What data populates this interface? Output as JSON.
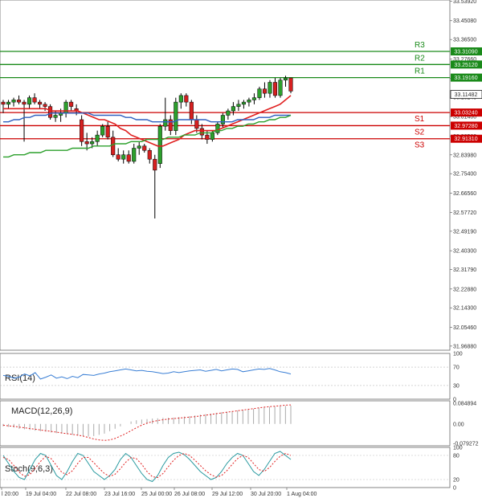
{
  "chart_data": {
    "type": "candlestick",
    "instrument_pane": {
      "ylim": [
        31.95,
        33.545
      ],
      "y_ticks": [
        "33.53920",
        "33.45080",
        "33.36500",
        "33.27660",
        "33.18820",
        "33.10240",
        "33.01400",
        "32.92560",
        "32.83980",
        "32.75400",
        "32.66560",
        "32.57720",
        "32.49190",
        "32.40300",
        "32.31790",
        "32.22880",
        "32.14300",
        "32.05460",
        "31.96880"
      ],
      "current_price": {
        "label": "33.11482",
        "value": 33.11482
      },
      "levels": [
        {
          "name": "R3",
          "value": 33.3109,
          "label": "33.31090",
          "color": "#1a8a1a"
        },
        {
          "name": "R2",
          "value": 33.2512,
          "label": "33.25120",
          "color": "#1a8a1a"
        },
        {
          "name": "R1",
          "value": 33.1916,
          "label": "33.19160",
          "color": "#1a8a1a"
        },
        {
          "name": "S1",
          "value": 33.0324,
          "label": "33.03240",
          "color": "#cc0000"
        },
        {
          "name": "S2",
          "value": 32.9728,
          "label": "32.97280",
          "color": "#cc0000"
        },
        {
          "name": "S3",
          "value": 32.9131,
          "label": "32.91310",
          "color": "#cc0000"
        }
      ],
      "candles": [
        {
          "o": 33.08,
          "h": 33.09,
          "l": 33.03,
          "c": 33.07
        },
        {
          "o": 33.07,
          "h": 33.09,
          "l": 33.05,
          "c": 33.08
        },
        {
          "o": 33.08,
          "h": 33.1,
          "l": 33.06,
          "c": 33.09
        },
        {
          "o": 33.09,
          "h": 33.11,
          "l": 33.07,
          "c": 33.08
        },
        {
          "o": 33.08,
          "h": 33.09,
          "l": 32.9,
          "c": 33.07
        },
        {
          "o": 33.07,
          "h": 33.11,
          "l": 33.05,
          "c": 33.1
        },
        {
          "o": 33.1,
          "h": 33.12,
          "l": 33.07,
          "c": 33.08
        },
        {
          "o": 33.08,
          "h": 33.09,
          "l": 33.05,
          "c": 33.07
        },
        {
          "o": 33.07,
          "h": 33.08,
          "l": 33.04,
          "c": 33.06
        },
        {
          "o": 33.06,
          "h": 33.07,
          "l": 33.0,
          "c": 33.01
        },
        {
          "o": 33.01,
          "h": 33.04,
          "l": 32.99,
          "c": 33.02
        },
        {
          "o": 33.02,
          "h": 33.05,
          "l": 32.99,
          "c": 33.03
        },
        {
          "o": 33.03,
          "h": 33.09,
          "l": 33.01,
          "c": 33.08
        },
        {
          "o": 33.08,
          "h": 33.09,
          "l": 33.04,
          "c": 33.06
        },
        {
          "o": 33.05,
          "h": 33.07,
          "l": 33.02,
          "c": 33.04
        },
        {
          "o": 33.0,
          "h": 33.02,
          "l": 32.88,
          "c": 32.9
        },
        {
          "o": 32.9,
          "h": 32.94,
          "l": 32.86,
          "c": 32.89
        },
        {
          "o": 32.89,
          "h": 32.92,
          "l": 32.87,
          "c": 32.9
        },
        {
          "o": 32.9,
          "h": 32.95,
          "l": 32.88,
          "c": 32.93
        },
        {
          "o": 32.93,
          "h": 32.98,
          "l": 32.92,
          "c": 32.97
        },
        {
          "o": 32.97,
          "h": 32.99,
          "l": 32.91,
          "c": 32.92
        },
        {
          "o": 32.92,
          "h": 32.95,
          "l": 32.83,
          "c": 32.84
        },
        {
          "o": 32.84,
          "h": 32.87,
          "l": 32.81,
          "c": 32.82
        },
        {
          "o": 32.82,
          "h": 32.86,
          "l": 32.8,
          "c": 32.84
        },
        {
          "o": 32.84,
          "h": 32.86,
          "l": 32.8,
          "c": 32.81
        },
        {
          "o": 32.81,
          "h": 32.89,
          "l": 32.8,
          "c": 32.87
        },
        {
          "o": 32.87,
          "h": 32.9,
          "l": 32.84,
          "c": 32.88
        },
        {
          "o": 32.88,
          "h": 32.89,
          "l": 32.85,
          "c": 32.86
        },
        {
          "o": 32.86,
          "h": 32.87,
          "l": 32.8,
          "c": 32.82
        },
        {
          "o": 32.82,
          "h": 32.84,
          "l": 32.55,
          "c": 32.77
        },
        {
          "o": 32.8,
          "h": 32.98,
          "l": 32.78,
          "c": 32.97
        },
        {
          "o": 32.97,
          "h": 33.1,
          "l": 32.95,
          "c": 33.0
        },
        {
          "o": 33.0,
          "h": 33.02,
          "l": 32.93,
          "c": 32.95
        },
        {
          "o": 32.95,
          "h": 33.1,
          "l": 32.93,
          "c": 33.08
        },
        {
          "o": 33.08,
          "h": 33.12,
          "l": 33.05,
          "c": 33.11
        },
        {
          "o": 33.11,
          "h": 33.12,
          "l": 33.06,
          "c": 33.08
        },
        {
          "o": 33.08,
          "h": 33.09,
          "l": 32.98,
          "c": 33.0
        },
        {
          "o": 33.0,
          "h": 33.02,
          "l": 32.94,
          "c": 32.96
        },
        {
          "o": 32.96,
          "h": 32.98,
          "l": 32.91,
          "c": 32.93
        },
        {
          "o": 32.93,
          "h": 32.95,
          "l": 32.89,
          "c": 32.91
        },
        {
          "o": 32.91,
          "h": 32.95,
          "l": 32.9,
          "c": 32.94
        },
        {
          "o": 32.94,
          "h": 32.99,
          "l": 32.93,
          "c": 32.98
        },
        {
          "o": 32.98,
          "h": 33.03,
          "l": 32.96,
          "c": 33.02
        },
        {
          "o": 33.02,
          "h": 33.05,
          "l": 33.0,
          "c": 33.04
        },
        {
          "o": 33.04,
          "h": 33.08,
          "l": 33.02,
          "c": 33.06
        },
        {
          "o": 33.06,
          "h": 33.09,
          "l": 33.04,
          "c": 33.07
        },
        {
          "o": 33.07,
          "h": 33.09,
          "l": 33.05,
          "c": 33.08
        },
        {
          "o": 33.08,
          "h": 33.1,
          "l": 33.06,
          "c": 33.09
        },
        {
          "o": 33.09,
          "h": 33.12,
          "l": 33.07,
          "c": 33.1
        },
        {
          "o": 33.1,
          "h": 33.15,
          "l": 33.09,
          "c": 33.14
        },
        {
          "o": 33.14,
          "h": 33.17,
          "l": 33.1,
          "c": 33.12
        },
        {
          "o": 33.12,
          "h": 33.18,
          "l": 33.1,
          "c": 33.17
        },
        {
          "o": 33.17,
          "h": 33.19,
          "l": 33.1,
          "c": 33.11
        },
        {
          "o": 33.11,
          "h": 33.19,
          "l": 33.1,
          "c": 33.18
        },
        {
          "o": 33.18,
          "h": 33.2,
          "l": 33.15,
          "c": 33.19
        },
        {
          "o": 33.19,
          "h": 33.19,
          "l": 33.12,
          "c": 33.13
        }
      ],
      "moving_averages": [
        {
          "color": "#e02020",
          "values": [
            33.05,
            33.05,
            33.05,
            33.05,
            33.05,
            33.05,
            33.05,
            33.05,
            33.05,
            33.04,
            33.04,
            33.04,
            33.04,
            33.04,
            33.04,
            33.03,
            33.02,
            33.01,
            33.0,
            33.0,
            32.99,
            32.98,
            32.96,
            32.95,
            32.93,
            32.92,
            32.91,
            32.9,
            32.89,
            32.88,
            32.88,
            32.89,
            32.9,
            32.91,
            32.93,
            32.94,
            32.95,
            32.95,
            32.95,
            32.95,
            32.95,
            32.96,
            32.97,
            32.98,
            32.99,
            33.0,
            33.01,
            33.02,
            33.03,
            33.04,
            33.05,
            33.06,
            33.07,
            33.09,
            33.11
          ]
        },
        {
          "color": "#3060c0",
          "values": [
            32.99,
            32.99,
            33.0,
            33.0,
            33.01,
            33.01,
            33.02,
            33.02,
            33.02,
            33.03,
            33.03,
            33.03,
            33.03,
            33.03,
            33.03,
            33.03,
            33.03,
            33.02,
            33.02,
            33.02,
            33.02,
            33.02,
            33.02,
            33.01,
            33.01,
            33.0,
            33.0,
            33.0,
            32.99,
            32.99,
            32.99,
            32.99,
            32.99,
            33.0,
            33.0,
            33.0,
            33.0,
            33.0,
            33.0,
            32.99,
            32.99,
            32.99,
            32.99,
            32.99,
            33.0,
            33.0,
            33.0,
            33.0,
            33.01,
            33.01,
            33.01,
            33.02,
            33.02,
            33.02,
            33.02
          ]
        },
        {
          "color": "#2ca02c",
          "values": [
            32.83,
            32.83,
            32.84,
            32.84,
            32.84,
            32.85,
            32.85,
            32.85,
            32.86,
            32.86,
            32.86,
            32.86,
            32.86,
            32.87,
            32.87,
            32.87,
            32.87,
            32.88,
            32.88,
            32.88,
            32.88,
            32.89,
            32.89,
            32.89,
            32.9,
            32.9,
            32.9,
            32.91,
            32.91,
            32.91,
            32.91,
            32.92,
            32.92,
            32.92,
            32.93,
            32.93,
            32.93,
            32.94,
            32.94,
            32.94,
            32.95,
            32.95,
            32.96,
            32.96,
            32.97,
            32.97,
            32.98,
            32.98,
            32.99,
            32.99,
            33.0,
            33.0,
            33.01,
            33.01,
            33.02
          ]
        }
      ]
    },
    "rsi": {
      "label": "RSI(14)",
      "ylim": [
        0,
        100
      ],
      "y_ticks": [
        "100",
        "70",
        "30",
        "0"
      ],
      "values": [
        52,
        50,
        46,
        48,
        55,
        51,
        58,
        44,
        48,
        53,
        46,
        49,
        45,
        50,
        47,
        54,
        53,
        52,
        55,
        57,
        60,
        62,
        64,
        66,
        64,
        62,
        63,
        61,
        60,
        58,
        56,
        57,
        60,
        58,
        60,
        62,
        63,
        64,
        61,
        63,
        65,
        62,
        64,
        66,
        65,
        60,
        62,
        64,
        66,
        65,
        67,
        64,
        60,
        58,
        55
      ]
    },
    "macd": {
      "label": "MACD(12,26,9)",
      "y_ticks": [
        "0.084894",
        "0.00",
        "-0.079272"
      ],
      "ylim": [
        -0.09,
        0.095
      ],
      "histogram": [
        -0.01,
        -0.012,
        -0.015,
        -0.02,
        -0.022,
        -0.025,
        -0.028,
        -0.03,
        -0.032,
        -0.035,
        -0.038,
        -0.04,
        -0.042,
        -0.045,
        -0.048,
        -0.05,
        -0.052,
        -0.05,
        -0.045,
        -0.04,
        -0.03,
        -0.02,
        -0.01,
        0.0,
        0.01,
        0.015,
        0.018,
        0.02,
        0.022,
        0.023,
        0.025,
        0.025,
        0.026,
        0.028,
        0.03,
        0.032,
        0.035,
        0.038,
        0.04,
        0.042,
        0.045,
        0.048,
        0.05,
        0.052,
        0.055,
        0.058,
        0.06,
        0.062,
        0.065,
        0.068,
        0.07,
        0.072,
        0.073,
        0.074,
        0.075
      ],
      "signal": [
        -0.005,
        -0.008,
        -0.01,
        -0.013,
        -0.016,
        -0.019,
        -0.022,
        -0.025,
        -0.028,
        -0.031,
        -0.034,
        -0.037,
        -0.04,
        -0.043,
        -0.046,
        -0.05,
        -0.056,
        -0.062,
        -0.066,
        -0.068,
        -0.066,
        -0.06,
        -0.05,
        -0.04,
        -0.028,
        -0.016,
        -0.005,
        0.003,
        0.009,
        0.014,
        0.017,
        0.02,
        0.022,
        0.024,
        0.026,
        0.028,
        0.03,
        0.033,
        0.036,
        0.039,
        0.042,
        0.045,
        0.048,
        0.051,
        0.054,
        0.057,
        0.06,
        0.063,
        0.066,
        0.069,
        0.071,
        0.073,
        0.075,
        0.077,
        0.078
      ]
    },
    "stoch": {
      "label": "Stoch(9,6,3)",
      "ylim": [
        0,
        100
      ],
      "y_ticks": [
        "100",
        "80",
        "20",
        "0"
      ],
      "main": [
        80,
        60,
        40,
        25,
        20,
        45,
        70,
        85,
        80,
        55,
        30,
        20,
        40,
        65,
        85,
        80,
        60,
        40,
        30,
        20,
        30,
        45,
        70,
        85,
        75,
        55,
        35,
        20,
        15,
        30,
        55,
        75,
        85,
        88,
        82,
        70,
        55,
        40,
        30,
        20,
        25,
        40,
        60,
        75,
        85,
        80,
        60,
        40,
        30,
        45,
        65,
        85,
        90,
        80,
        70
      ],
      "signal": [
        75,
        70,
        55,
        38,
        28,
        32,
        48,
        65,
        78,
        72,
        55,
        38,
        32,
        42,
        60,
        75,
        75,
        62,
        48,
        35,
        28,
        33,
        47,
        63,
        75,
        72,
        58,
        40,
        27,
        25,
        35,
        52,
        68,
        80,
        85,
        80,
        68,
        55,
        42,
        32,
        26,
        30,
        42,
        58,
        72,
        80,
        75,
        60,
        45,
        40,
        50,
        65,
        78,
        85,
        80
      ]
    },
    "x_ticks": [
      "l 20:00",
      "19 Jul 04:00",
      "22 Jul 08:00",
      "23 Jul 16:00",
      "25 Jul 00:00",
      "26 Jul 08:00",
      "29 Jul 12:00",
      "30 Jul 20:00",
      "1 Aug 04:00"
    ]
  },
  "colors": {
    "up_body": "#2ca02c",
    "down_body": "#d62020",
    "candle_wick": "#000000",
    "resistance": "#1a8a1a",
    "support": "#cc0000",
    "rsi_line": "#3a7fd5",
    "macd_hist": "#aaaaaa",
    "macd_signal": "#e02020",
    "stoch_main": "#2a9aa0",
    "stoch_signal": "#e02020"
  }
}
